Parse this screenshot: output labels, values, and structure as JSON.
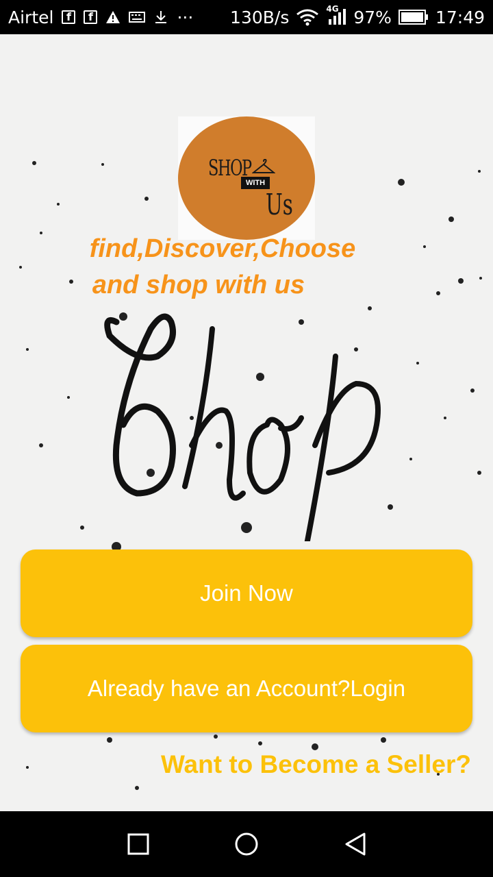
{
  "status_bar": {
    "carrier": "Airtel",
    "net_speed": "130B/s",
    "network_type": "4G",
    "battery": "97%",
    "time": "17:49",
    "icons": [
      "facebook-icon",
      "facebook-icon",
      "warning-icon",
      "keyboard-icon",
      "download-icon",
      "more-icon",
      "wifi-icon",
      "signal-icon",
      "battery-icon"
    ]
  },
  "logo": {
    "line1": "SHOP",
    "line2": "WITH",
    "line3": "Us"
  },
  "tagline": {
    "line1": "find,Discover,Choose",
    "line2": "and shop with us"
  },
  "background_art_text": "Shop",
  "buttons": {
    "join": "Join Now",
    "login": "Already have an Account?Login"
  },
  "seller_link": "Want to Become a Seller?",
  "colors": {
    "button": "#fcc10a",
    "tagline": "#f7931a",
    "logo_circle": "#d07d2c",
    "seller_link": "#fcc10a"
  },
  "nav_bar": {
    "icons": [
      "recent-apps-icon",
      "home-icon",
      "back-icon"
    ]
  }
}
